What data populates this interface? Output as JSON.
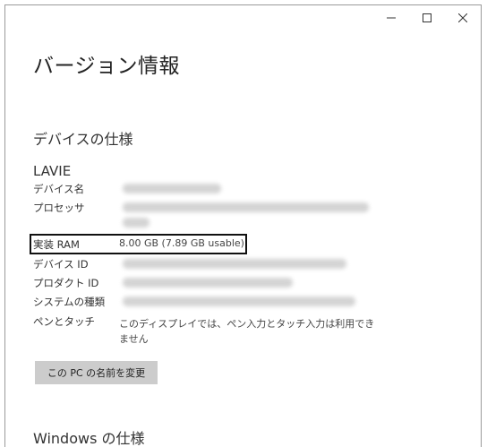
{
  "window": {
    "controls": {
      "minimize": "−",
      "maximize": "☐",
      "close": "✕"
    }
  },
  "page": {
    "title": "バージョン情報",
    "device_spec_heading": "デバイスの仕様",
    "device_model": "LAVIE",
    "windows_spec_heading": "Windows の仕様"
  },
  "specs": {
    "device_name_label": "デバイス名",
    "processor_label": "プロセッサ",
    "ram_label": "実装 RAM",
    "ram_value": "8.00 GB (7.89 GB usable)",
    "device_id_label": "デバイス ID",
    "product_id_label": "プロダクト ID",
    "system_type_label": "システムの種類",
    "pen_touch_label": "ペンとタッチ",
    "pen_touch_value": "このディスプレイでは、ペン入力とタッチ入力は利用できません"
  },
  "actions": {
    "rename_pc": "この PC の名前を変更"
  }
}
